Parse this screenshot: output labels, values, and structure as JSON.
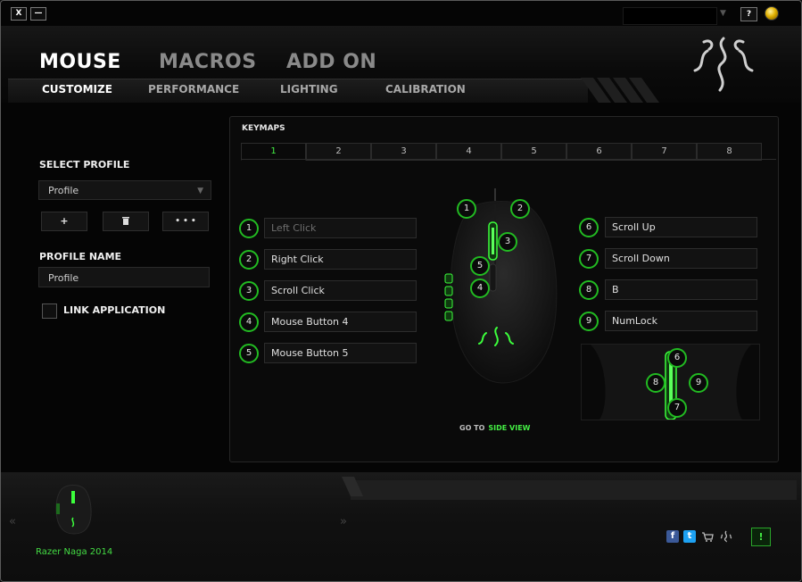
{
  "window": {
    "close_label": "X",
    "minimize_label": "—",
    "help_label": "?"
  },
  "tabs": {
    "main": [
      {
        "label": "MOUSE",
        "active": true
      },
      {
        "label": "MACROS",
        "active": false
      },
      {
        "label": "ADD ON",
        "active": false
      }
    ],
    "sub": [
      {
        "label": "CUSTOMIZE",
        "active": true
      },
      {
        "label": "PERFORMANCE",
        "active": false
      },
      {
        "label": "LIGHTING",
        "active": false
      },
      {
        "label": "CALIBRATION",
        "active": false
      }
    ]
  },
  "profile": {
    "select_label": "SELECT PROFILE",
    "selected": "Profile",
    "add_label": "+",
    "delete_icon": "trash-icon",
    "more_label": "• • •",
    "name_label": "PROFILE NAME",
    "name_value": "Profile",
    "link_label": "LINK APPLICATION",
    "link_checked": false
  },
  "keymaps": {
    "title": "KEYMAPS",
    "tabs": [
      "1",
      "2",
      "3",
      "4",
      "5",
      "6",
      "7",
      "8"
    ],
    "active_tab": "1",
    "left_assignments": [
      {
        "num": "1",
        "label": "Left Click"
      },
      {
        "num": "2",
        "label": "Right Click"
      },
      {
        "num": "3",
        "label": "Scroll Click"
      },
      {
        "num": "4",
        "label": "Mouse Button 4"
      },
      {
        "num": "5",
        "label": "Mouse Button 5"
      }
    ],
    "right_assignments": [
      {
        "num": "6",
        "label": "Scroll Up"
      },
      {
        "num": "7",
        "label": "Scroll Down"
      },
      {
        "num": "8",
        "label": "B"
      },
      {
        "num": "9",
        "label": "NumLock"
      }
    ],
    "mouse_badges": [
      "1",
      "2",
      "3",
      "5",
      "4"
    ],
    "side_badges": [
      "6",
      "8",
      "9",
      "7"
    ],
    "goto_prefix": "GO TO",
    "goto_link": "SIDE VIEW"
  },
  "device": {
    "name": "Razer Naga 2014"
  },
  "footer": {
    "alert_label": "!",
    "facebook": "f",
    "twitter": "t"
  },
  "colors": {
    "accent": "#44ee44",
    "badge_ring": "#22bb22",
    "background": "#050505"
  }
}
